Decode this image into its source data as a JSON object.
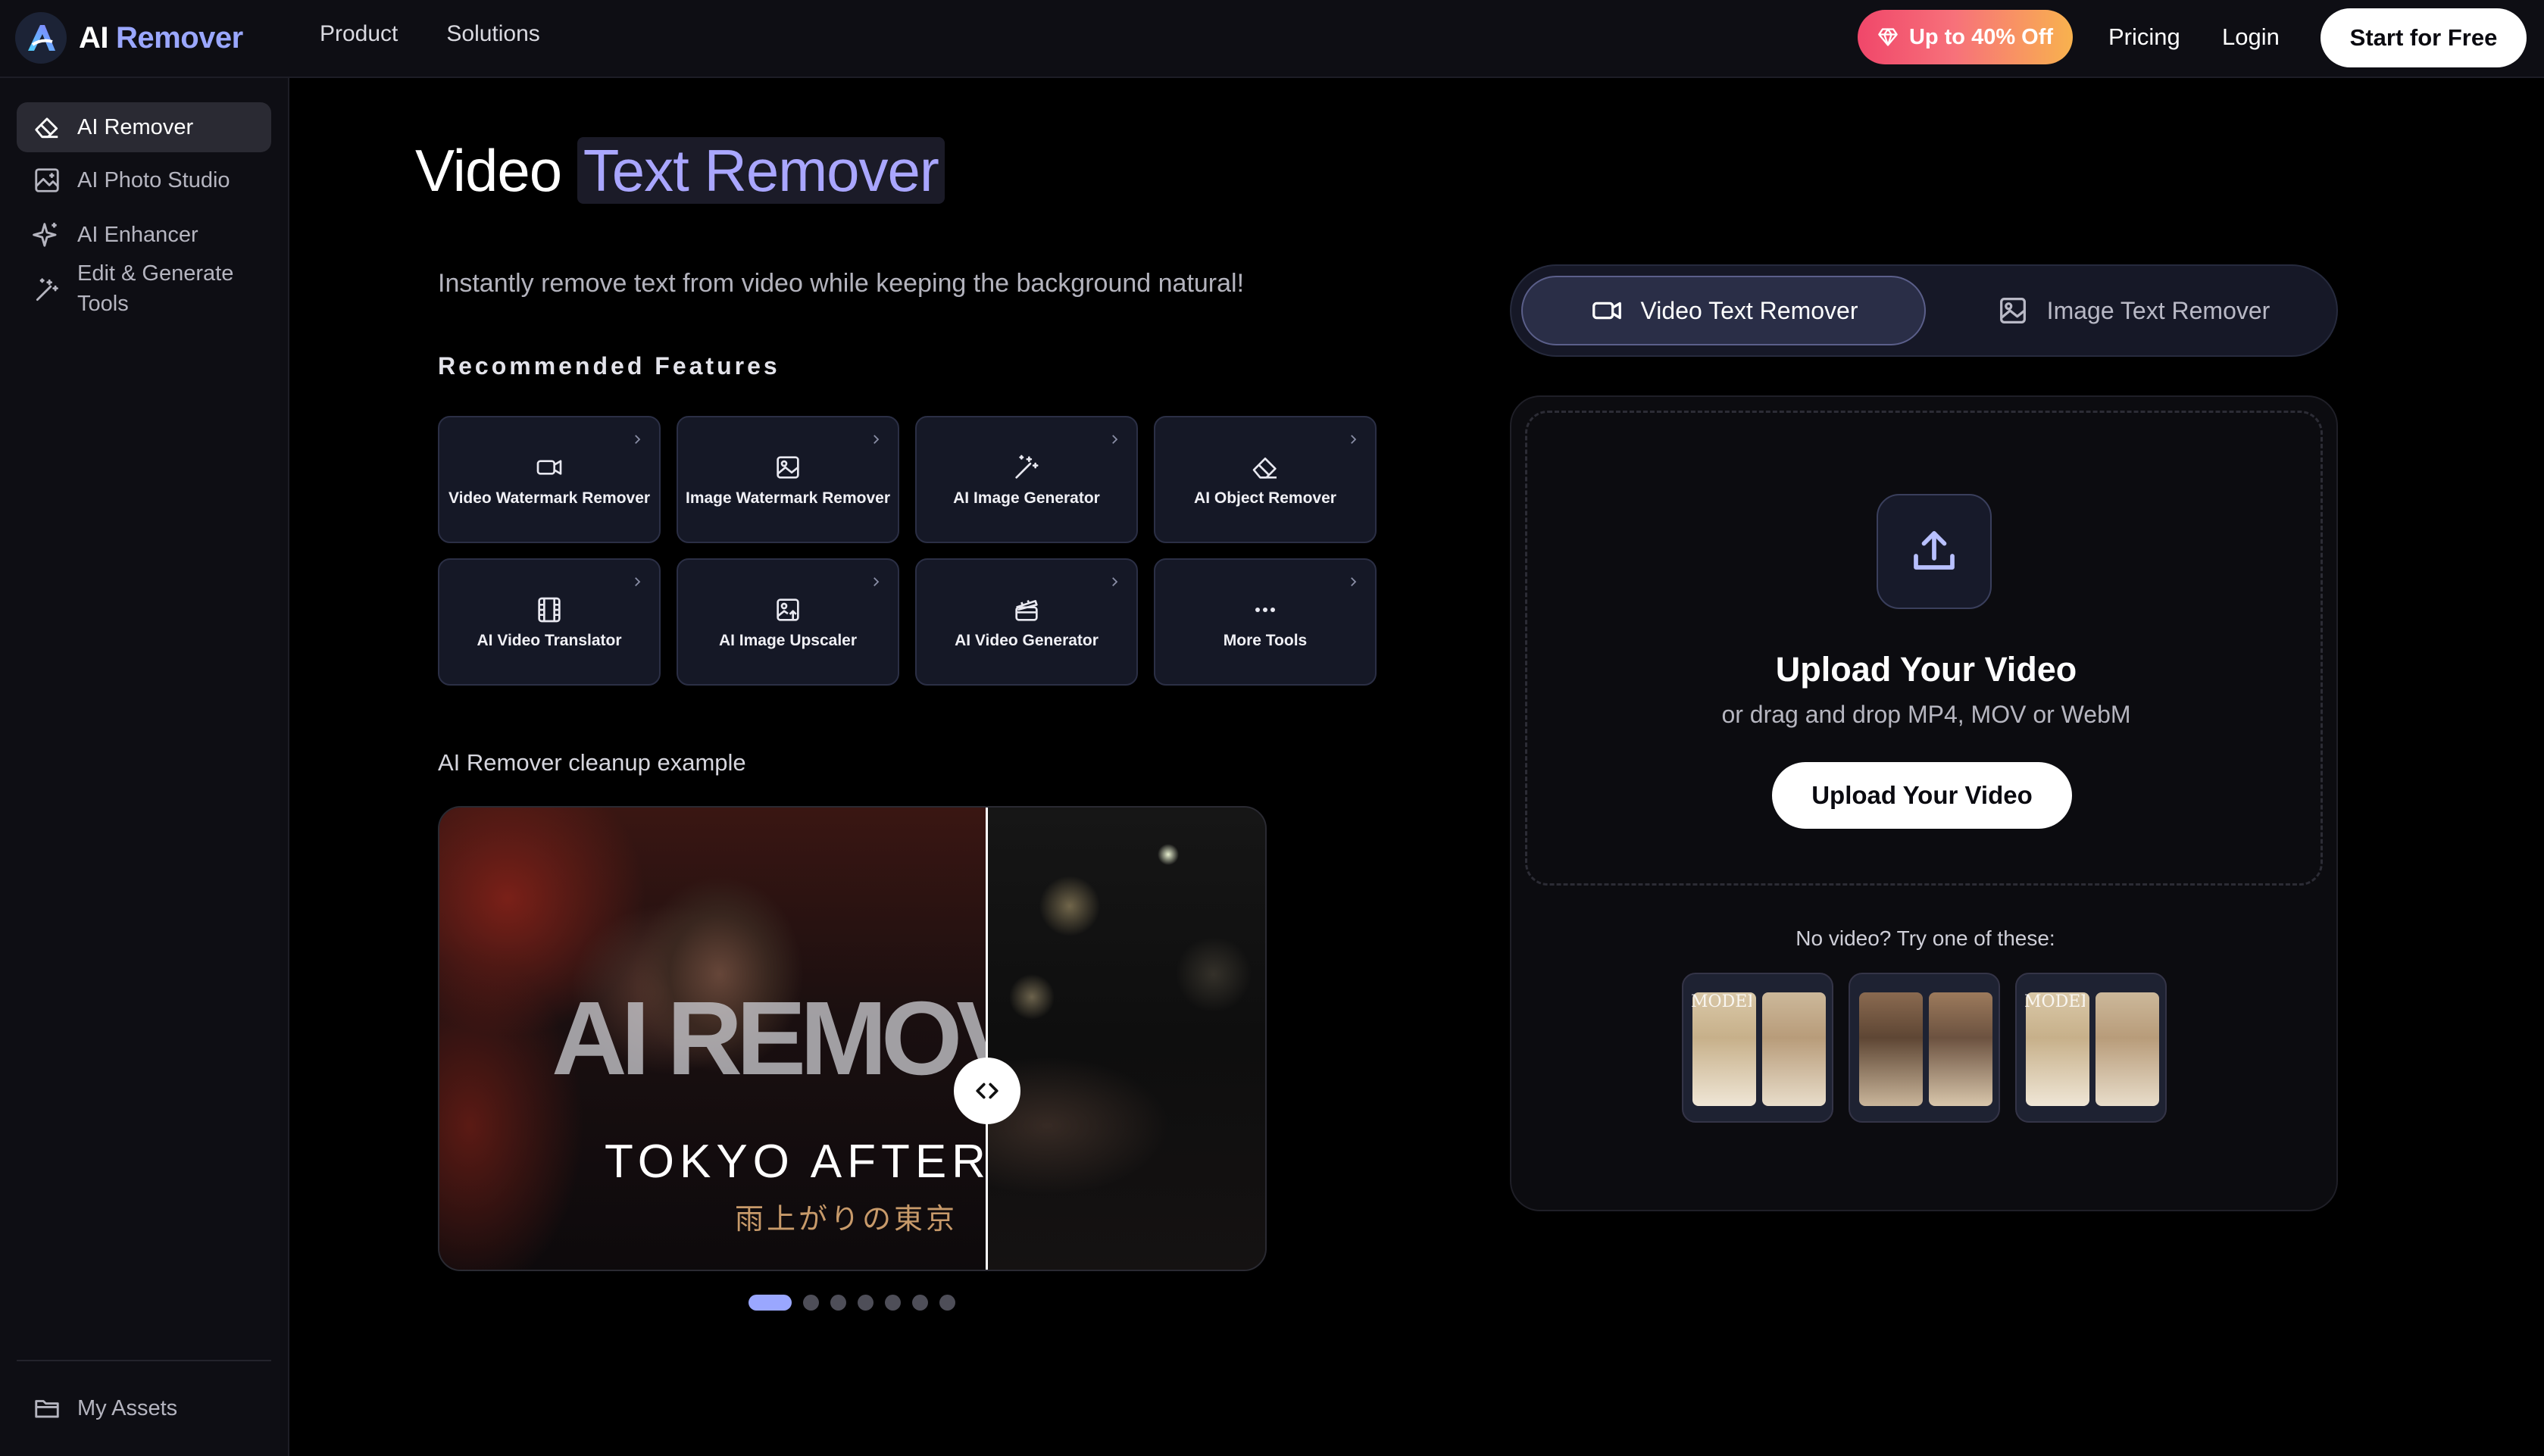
{
  "header": {
    "logo_ai": "AI",
    "logo_remover": "Remover",
    "nav": [
      "Product",
      "Solutions"
    ],
    "promo": "Up to 40% Off",
    "pricing": "Pricing",
    "login": "Login",
    "start": "Start for Free"
  },
  "sidebar": {
    "items": [
      {
        "label": "AI Remover",
        "icon": "eraser-icon",
        "active": true
      },
      {
        "label": "AI Photo Studio",
        "icon": "photo-studio-icon"
      },
      {
        "label": "AI Enhancer",
        "icon": "sparkle-icon"
      },
      {
        "label": "Edit & Generate Tools",
        "icon": "magic-wand-icon"
      }
    ],
    "footer": {
      "label": "My Assets",
      "icon": "folder-icon"
    }
  },
  "main": {
    "title_prefix": "Video",
    "title_highlight": "Text Remover",
    "subtitle": "Instantly remove text from video while keeping the background natural!",
    "recommended_title": "Recommended Features",
    "features": [
      {
        "label": "Video Watermark Remover",
        "icon": "video-camera-icon"
      },
      {
        "label": "Image Watermark Remover",
        "icon": "image-icon"
      },
      {
        "label": "AI Image Generator",
        "icon": "magic-wand-icon"
      },
      {
        "label": "AI Object Remover",
        "icon": "eraser-icon"
      },
      {
        "label": "AI Video Translator",
        "icon": "film-icon"
      },
      {
        "label": "AI Image Upscaler",
        "icon": "image-upscale-icon"
      },
      {
        "label": "AI Video Generator",
        "icon": "clapperboard-icon"
      },
      {
        "label": "More Tools",
        "icon": "more-dots-icon"
      }
    ],
    "example_title": "AI Remover cleanup example",
    "example": {
      "overlay_big": "AI REMOVER",
      "overlay_sub": "TOKYO AFTER RAIN",
      "overlay_jp": "雨上がりの東京"
    },
    "carousel": {
      "count": 7,
      "active": 0
    }
  },
  "panel": {
    "tabs": [
      {
        "label": "Video Text Remover",
        "icon": "video-camera-icon",
        "active": true
      },
      {
        "label": "Image Text Remover",
        "icon": "image-icon",
        "active": false
      }
    ],
    "upload_title": "Upload Your Video",
    "upload_sub": "or drag and drop MP4, MOV or WebM",
    "upload_button": "Upload Your Video",
    "try_label": "No video? Try one of these:",
    "samples": [
      "MODERN VISION",
      "",
      "MODERN VISION"
    ]
  },
  "colors": {
    "accent": "#9aa7ff",
    "background": "#000000",
    "surface": "#0e0e14"
  }
}
